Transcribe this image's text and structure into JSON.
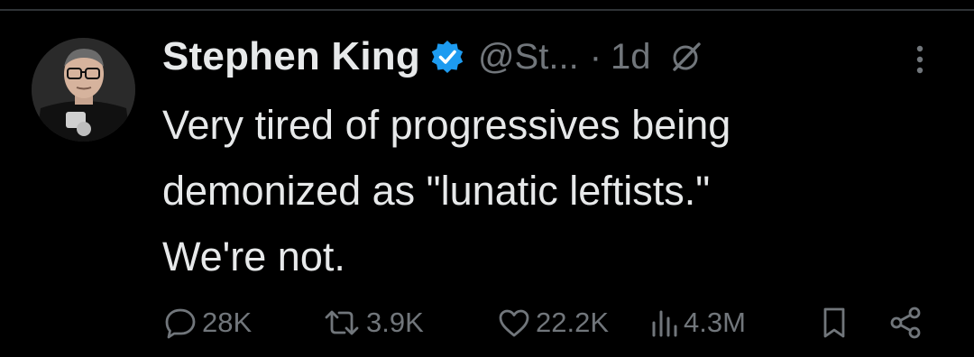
{
  "tweet": {
    "author": {
      "display_name": "Stephen King",
      "handle": "@St...",
      "verified": true,
      "verified_color": "#1d9bf0"
    },
    "separator": "·",
    "timestamp": "1d",
    "text": "Very tired of progressives being\ndemonized as \"lunatic leftists.\"\nWe're not.",
    "metrics": {
      "replies": "28K",
      "reposts": "3.9K",
      "likes": "22.2K",
      "views": "4.3M"
    }
  },
  "icons": {
    "avatar": "avatar-photo",
    "verified": "verified-badge-icon",
    "grok": "grok-icon",
    "more": "more-vertical-icon",
    "reply": "reply-icon",
    "repost": "repost-icon",
    "like": "heart-icon",
    "views": "views-icon",
    "bookmark": "bookmark-icon",
    "share": "share-icon"
  },
  "colors": {
    "background": "#000000",
    "text_primary": "#e7e9ea",
    "text_secondary": "#71767b",
    "divider": "#2f3336"
  }
}
